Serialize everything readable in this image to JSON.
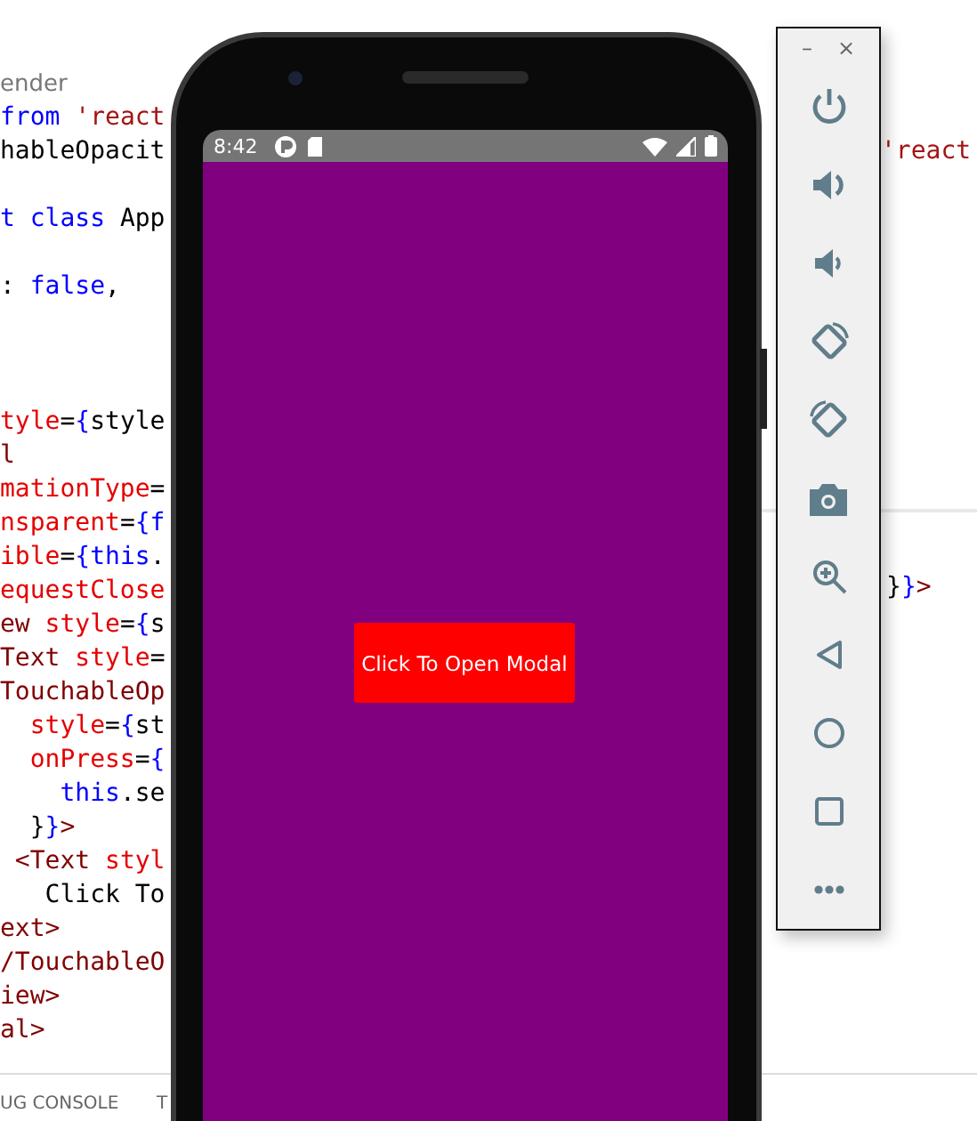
{
  "editor": {
    "breadcrumb": "ender",
    "lines": [
      {
        "kind": "code",
        "tokens": [
          {
            "kind": "kw",
            "text": "from "
          },
          {
            "kind": "str",
            "text": "'react"
          }
        ]
      },
      {
        "kind": "code",
        "tokens": [
          {
            "kind": "plain",
            "text": "hableOpacit"
          }
        ]
      },
      {
        "kind": "blank"
      },
      {
        "kind": "code",
        "tokens": [
          {
            "kind": "kw",
            "text": "t class "
          },
          {
            "kind": "plain",
            "text": "App"
          }
        ]
      },
      {
        "kind": "blank"
      },
      {
        "kind": "code",
        "tokens": [
          {
            "kind": "plain",
            "text": ": "
          },
          {
            "kind": "kw",
            "text": "false"
          },
          {
            "kind": "plain",
            "text": ","
          }
        ]
      },
      {
        "kind": "blank"
      },
      {
        "kind": "blank"
      },
      {
        "kind": "blank"
      },
      {
        "kind": "code",
        "tokens": [
          {
            "kind": "attr",
            "text": "tyle"
          },
          {
            "kind": "plain",
            "text": "="
          },
          {
            "kind": "kw",
            "text": "{"
          },
          {
            "kind": "plain",
            "text": "style"
          }
        ]
      },
      {
        "kind": "code",
        "tokens": [
          {
            "kind": "tag",
            "text": "l"
          }
        ]
      },
      {
        "kind": "code",
        "tokens": [
          {
            "kind": "attr",
            "text": "mationType"
          },
          {
            "kind": "plain",
            "text": "="
          }
        ]
      },
      {
        "kind": "code",
        "tokens": [
          {
            "kind": "attr",
            "text": "nsparent"
          },
          {
            "kind": "plain",
            "text": "="
          },
          {
            "kind": "kw",
            "text": "{f"
          }
        ]
      },
      {
        "kind": "code",
        "tokens": [
          {
            "kind": "attr",
            "text": "ible"
          },
          {
            "kind": "plain",
            "text": "="
          },
          {
            "kind": "kw",
            "text": "{this"
          },
          {
            "kind": "plain",
            "text": "."
          }
        ]
      },
      {
        "kind": "code",
        "tokens": [
          {
            "kind": "attr",
            "text": "equestClose"
          }
        ]
      },
      {
        "kind": "code",
        "tokens": [
          {
            "kind": "tag",
            "text": "ew "
          },
          {
            "kind": "attr",
            "text": "style"
          },
          {
            "kind": "plain",
            "text": "="
          },
          {
            "kind": "kw",
            "text": "{"
          },
          {
            "kind": "plain",
            "text": "s"
          }
        ]
      },
      {
        "kind": "code",
        "tokens": [
          {
            "kind": "tag",
            "text": "Text "
          },
          {
            "kind": "attr",
            "text": "style"
          },
          {
            "kind": "plain",
            "text": "="
          }
        ]
      },
      {
        "kind": "code",
        "tokens": [
          {
            "kind": "tag",
            "text": "TouchableOp"
          }
        ]
      },
      {
        "kind": "code",
        "tokens": [
          {
            "kind": "attr",
            "text": "  style"
          },
          {
            "kind": "plain",
            "text": "="
          },
          {
            "kind": "kw",
            "text": "{"
          },
          {
            "kind": "plain",
            "text": "st"
          }
        ]
      },
      {
        "kind": "code",
        "tokens": [
          {
            "kind": "attr",
            "text": "  onPress"
          },
          {
            "kind": "plain",
            "text": "="
          },
          {
            "kind": "kw",
            "text": "{"
          }
        ]
      },
      {
        "kind": "code",
        "tokens": [
          {
            "kind": "kw",
            "text": "    this"
          },
          {
            "kind": "plain",
            "text": ".se"
          }
        ]
      },
      {
        "kind": "code",
        "tokens": [
          {
            "kind": "plain",
            "text": "  }"
          },
          {
            "kind": "kw",
            "text": "}"
          },
          {
            "kind": "tag",
            "text": ">"
          }
        ]
      },
      {
        "kind": "code",
        "tokens": [
          {
            "kind": "tag",
            "text": " <Text "
          },
          {
            "kind": "attr",
            "text": "styl"
          }
        ]
      },
      {
        "kind": "code",
        "tokens": [
          {
            "kind": "plain",
            "text": "   Click To"
          }
        ]
      },
      {
        "kind": "code",
        "tokens": [
          {
            "kind": "tag",
            "text": "ext>"
          }
        ]
      },
      {
        "kind": "code",
        "tokens": [
          {
            "kind": "tag",
            "text": "/TouchableO"
          }
        ]
      },
      {
        "kind": "code",
        "tokens": [
          {
            "kind": "tag",
            "text": "iew>"
          }
        ]
      },
      {
        "kind": "code",
        "tokens": [
          {
            "kind": "tag",
            "text": "al>"
          }
        ]
      }
    ],
    "right_pane": [
      {
        "tokens": [
          {
            "kind": "str",
            "text": "'react"
          }
        ]
      },
      {
        "tokens": [
          {
            "kind": "plain",
            "text": "}"
          },
          {
            "kind": "kw",
            "text": "}"
          },
          {
            "kind": "tag",
            "text": ">"
          }
        ]
      }
    ],
    "panel_tabs": [
      "UG CONSOLE",
      "T"
    ]
  },
  "phone": {
    "status_bar": {
      "time": "8:42"
    },
    "button": {
      "label": "Click To Open Modal"
    }
  },
  "emulator_toolbar": {
    "minimize": "–",
    "close": "×"
  }
}
